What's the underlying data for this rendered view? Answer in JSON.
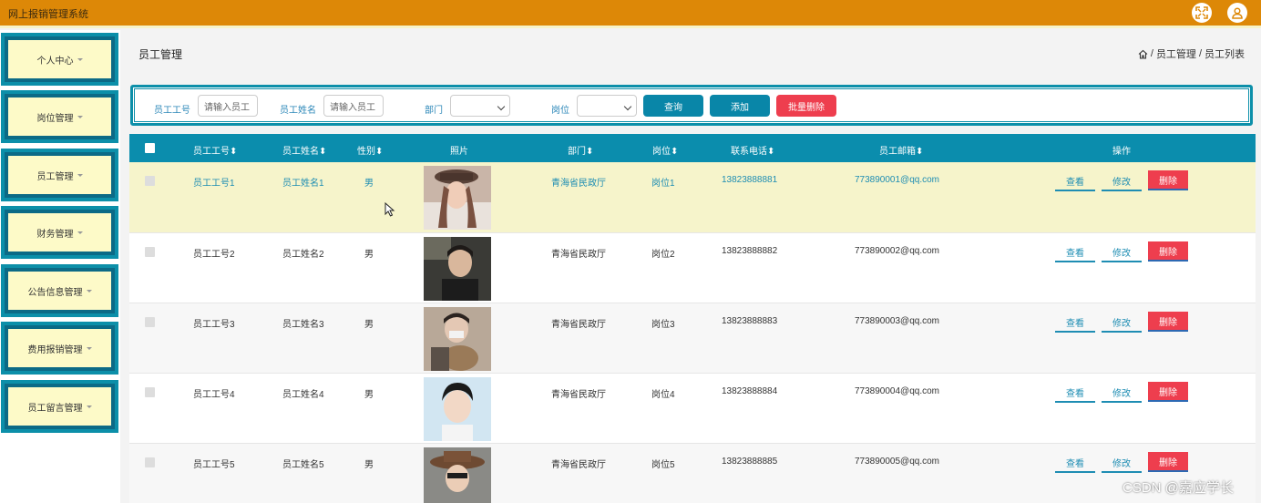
{
  "app": {
    "title": "网上报销管理系统"
  },
  "sidebar": {
    "items": [
      {
        "label": "个人中心"
      },
      {
        "label": "岗位管理"
      },
      {
        "label": "员工管理"
      },
      {
        "label": "财务管理"
      },
      {
        "label": "公告信息管理"
      },
      {
        "label": "费用报销管理"
      },
      {
        "label": "员工留言管理"
      }
    ]
  },
  "page": {
    "title": "员工管理",
    "breadcrumb": {
      "sep": "/",
      "level1": "员工管理",
      "level2": "员工列表"
    }
  },
  "search": {
    "emp_no_label": "员工工号",
    "emp_no_placeholder": "请输入员工",
    "emp_name_label": "员工姓名",
    "emp_name_placeholder": "请输入员工",
    "dept_label": "部门",
    "post_label": "岗位",
    "query_btn": "查询",
    "add_btn": "添加",
    "batch_delete_btn": "批量删除"
  },
  "table": {
    "headers": {
      "emp_no": "员工工号",
      "emp_name": "员工姓名",
      "gender": "性别",
      "photo": "照片",
      "dept": "部门",
      "post": "岗位",
      "phone": "联系电话",
      "email": "员工邮箱",
      "ops": "操作"
    },
    "actions": {
      "view": "查看",
      "edit": "修改",
      "delete": "删除"
    },
    "rows": [
      {
        "emp_no": "员工工号1",
        "emp_name": "员工姓名1",
        "gender": "男",
        "dept": "青海省民政厅",
        "post": "岗位1",
        "phone": "13823888881",
        "email": "773890001@qq.com"
      },
      {
        "emp_no": "员工工号2",
        "emp_name": "员工姓名2",
        "gender": "男",
        "dept": "青海省民政厅",
        "post": "岗位2",
        "phone": "13823888882",
        "email": "773890002@qq.com"
      },
      {
        "emp_no": "员工工号3",
        "emp_name": "员工姓名3",
        "gender": "男",
        "dept": "青海省民政厅",
        "post": "岗位3",
        "phone": "13823888883",
        "email": "773890003@qq.com"
      },
      {
        "emp_no": "员工工号4",
        "emp_name": "员工姓名4",
        "gender": "男",
        "dept": "青海省民政厅",
        "post": "岗位4",
        "phone": "13823888884",
        "email": "773890004@qq.com"
      },
      {
        "emp_no": "员工工号5",
        "emp_name": "员工姓名5",
        "gender": "男",
        "dept": "青海省民政厅",
        "post": "岗位5",
        "phone": "13823888885",
        "email": "773890005@qq.com"
      }
    ]
  },
  "watermark": "CSDN @嘉应学长",
  "colors": {
    "topbar": "#dd8807",
    "accent": "#0b8dad",
    "danger": "#ee3e4e",
    "sidebar_bg": "#fdfac8",
    "highlight_row": "#f6f4cb"
  }
}
